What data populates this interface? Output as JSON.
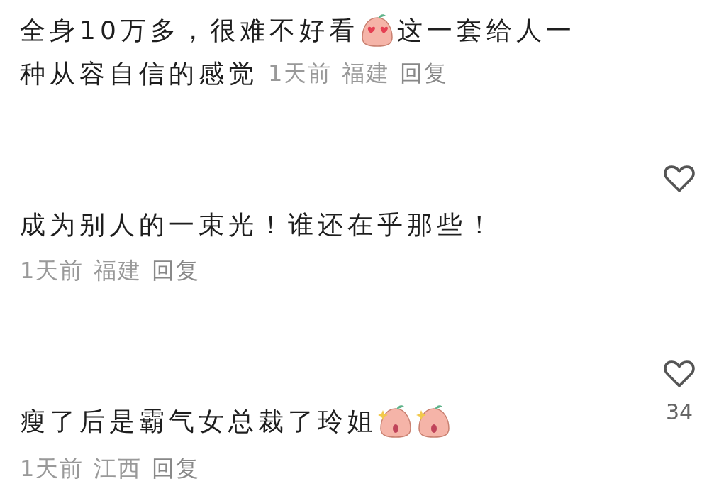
{
  "comments": [
    {
      "kind": "inline_meta",
      "parts": [
        {
          "kind": "text",
          "text": "全身10万多，很难不好看"
        },
        {
          "kind": "heart_eyes_emoji"
        },
        {
          "kind": "text",
          "text": "这一套给人一"
        },
        {
          "kind": "text",
          "text": "种从容自信的感觉"
        }
      ],
      "time": "1天前",
      "location": "福建",
      "reply": "回复"
    },
    {
      "kind": "block_meta",
      "parts": [
        {
          "kind": "text",
          "text": "成为别人的一束光！谁还在乎那些！"
        }
      ],
      "time": "1天前",
      "location": "福建",
      "reply": "回复",
      "liked": false
    },
    {
      "kind": "block_meta",
      "parts": [
        {
          "kind": "text",
          "text": "瘦了后是霸气女总裁了玲姐"
        },
        {
          "kind": "shout_emoji"
        },
        {
          "kind": "shout_emoji"
        }
      ],
      "time": "1天前",
      "location": "江西",
      "reply": "回复",
      "liked": false,
      "like_count": "34"
    }
  ]
}
